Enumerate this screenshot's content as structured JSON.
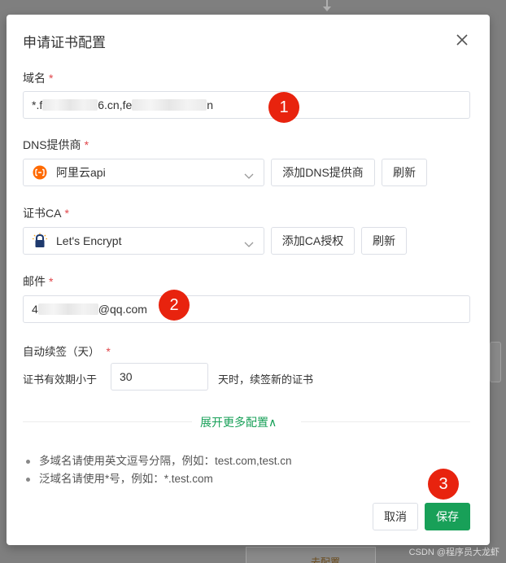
{
  "background": {
    "bottom_button_text": "去配置",
    "watermark": "CSDN @程序员大龙虾"
  },
  "dialog": {
    "title": "申请证书配置",
    "close_icon": "close-icon"
  },
  "domain": {
    "label": "域名",
    "required": "*",
    "value_prefix": "*.f",
    "value_mid": "6.cn,fe",
    "value_suffix": "n"
  },
  "dns": {
    "label": "DNS提供商",
    "required": "*",
    "selected": "阿里云api",
    "icon": "aliyun-icon",
    "add_button": "添加DNS提供商",
    "refresh_button": "刷新"
  },
  "ca": {
    "label": "证书CA",
    "required": "*",
    "selected": "Let's Encrypt",
    "icon": "letsencrypt-icon",
    "add_button": "添加CA授权",
    "refresh_button": "刷新"
  },
  "email": {
    "label": "邮件",
    "required": "*",
    "value_prefix": "4",
    "value_suffix": "@qq.com"
  },
  "renew": {
    "label": "自动续签（天）",
    "required": "*",
    "prefix_text": "证书有效期小于",
    "days_value": "30",
    "suffix_text": "天时，续签新的证书"
  },
  "expand": {
    "label": "展开更多配置∧"
  },
  "tips": [
    "多域名请使用英文逗号分隔，例如：test.com,test.cn",
    "泛域名请使用*号，例如：*.test.com"
  ],
  "footer": {
    "cancel_button": "取消",
    "save_button": "保存"
  },
  "badges": [
    "1",
    "2",
    "3"
  ],
  "colors": {
    "primary": "#18a058",
    "required": "#e0464a",
    "badge": "#e8230e",
    "aliyun": "#ff6a00"
  }
}
